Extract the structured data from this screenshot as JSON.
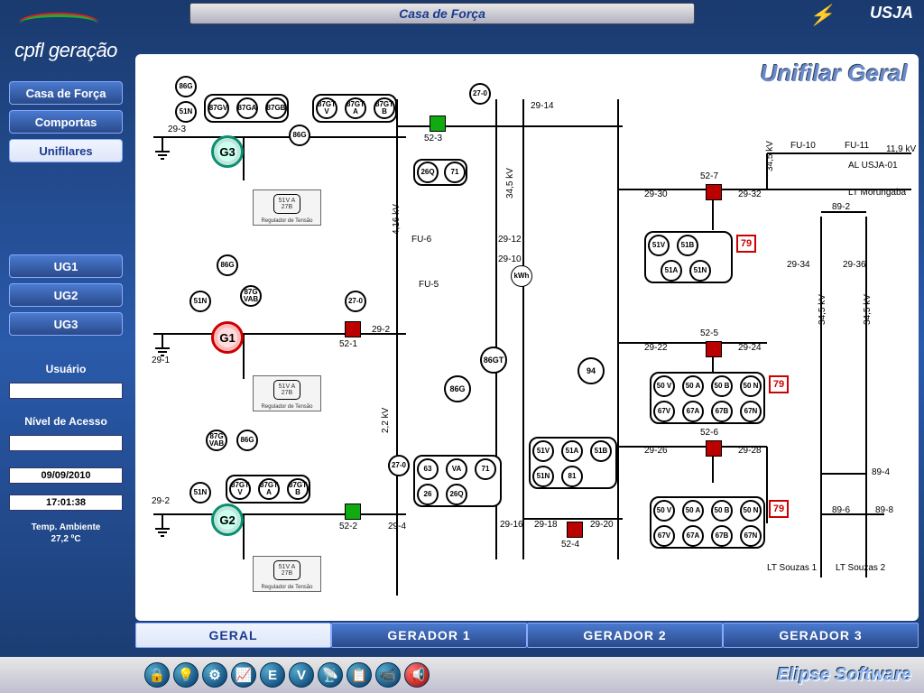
{
  "header": {
    "title": "Casa de Força",
    "site": "USJA"
  },
  "logo_text": "cpfl geração",
  "sidebar": {
    "nav": [
      {
        "label": "Casa de Força",
        "active": false
      },
      {
        "label": "Comportas",
        "active": false
      },
      {
        "label": "Unifilares",
        "active": true
      }
    ],
    "ug": [
      {
        "label": "UG1"
      },
      {
        "label": "UG2"
      },
      {
        "label": "UG3"
      }
    ],
    "user_label": "Usuário",
    "user_value": "",
    "access_label": "Nível de Acesso",
    "access_value": "",
    "date": "09/09/2010",
    "time": "17:01:38",
    "temp_label": "Temp. Ambiente",
    "temp_value": "27,2 ºC"
  },
  "main": {
    "title": "Unifilar Geral",
    "generators": {
      "G1": "G1",
      "G2": "G2",
      "G3": "G3"
    },
    "regulator_label": "Regulador de Tensão",
    "reg_inner": "51V A 27B",
    "voltages": {
      "v416": "4,16 kV",
      "v22": "2,2 kV",
      "v345": "34,5 kV",
      "v119": "11,9 kV"
    },
    "labels": {
      "29_1": "29-1",
      "29_2": "29-2",
      "29_3": "29-3",
      "29_4": "29-4",
      "29_10": "29-10",
      "29_12": "29-12",
      "29_14": "29-14",
      "29_16": "29-16",
      "29_18": "29-18",
      "29_20": "29-20",
      "29_22": "29-22",
      "29_24": "29-24",
      "29_26": "29-26",
      "29_28": "29-28",
      "29_30": "29-30",
      "29_32": "29-32",
      "29_34": "29-34",
      "29_36": "29-36",
      "52_1": "52-1",
      "52_2": "52-2",
      "52_3": "52-3",
      "52_4": "52-4",
      "52_5": "52-5",
      "52_6": "52-6",
      "52_7": "52-7",
      "89_2": "89-2",
      "89_4": "89-4",
      "89_6": "89-6",
      "89_8": "89-8",
      "fu5": "FU-5",
      "fu6": "FU-6",
      "fu10": "FU-10",
      "fu11": "FU-11",
      "al": "AL USJA-01",
      "morungaba": "LT Morungaba",
      "souzas1": "LT Souzas 1",
      "souzas2": "LT Souzas 2",
      "kwh": "kWh"
    },
    "relays": {
      "r27_0": "27-0",
      "r86G": "86G",
      "r51N": "51N",
      "r87GV": "87GV",
      "r87GA": "87GA",
      "r87GB": "87GB",
      "r87GTV": "87GT V",
      "r87GTA": "87GT A",
      "r87GTB": "87GT B",
      "r26Q": "26Q",
      "r71": "71",
      "r94": "94",
      "r86GT": "86GT",
      "r63": "63",
      "rVA": "VA",
      "r26": "26",
      "r51V": "51V",
      "r51A": "51A",
      "r51B": "51B",
      "r81": "81",
      "r79": "79",
      "r67V": "67V",
      "r67A": "67A",
      "r67B": "67B",
      "r67N": "67N",
      "r50V": "50 V",
      "r50A": "50 A",
      "r50B": "50 B",
      "r50N": "50 N",
      "r87GVAB": "87G VAB"
    }
  },
  "tabs": [
    {
      "label": "GERAL",
      "active": true
    },
    {
      "label": "GERADOR 1",
      "active": false
    },
    {
      "label": "GERADOR 2",
      "active": false
    },
    {
      "label": "GERADOR 3",
      "active": false
    }
  ],
  "footer_brand": "Elipse Software",
  "tool_icons": [
    "🔒",
    "💡",
    "⚙",
    "📈",
    "E",
    "V",
    "📡",
    "📋",
    "📹",
    "📢"
  ]
}
